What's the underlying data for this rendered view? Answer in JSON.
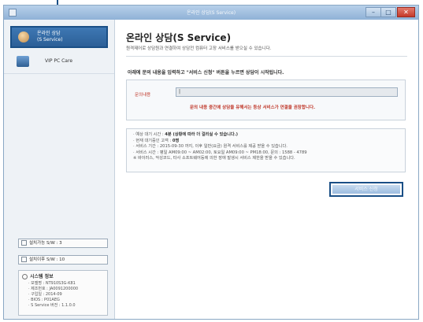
{
  "window": {
    "title": "온라인 상담(S Service)",
    "min_symbol": "–",
    "max_symbol": "□",
    "close_symbol": "✕"
  },
  "sidebar": {
    "active_item": {
      "line1": "온라인 상담",
      "line2": "(S Service)",
      "icon": "consultant-avatar-icon"
    },
    "vip_item": {
      "label": "VIP PC Care",
      "icon": "monitor-icon"
    },
    "buttons": [
      {
        "label": "설치가능 S/W : 3",
        "icon": "software-icon"
      },
      {
        "label": "설치이후 S/W : 10",
        "icon": "software-icon"
      }
    ],
    "system_info": {
      "title": "시스템 정보",
      "rows": [
        "· 모델명 : NT910S3G-K81",
        "· 제조번호 : JA0091200000",
        "· 구입일 : 2014-09",
        "· BIOS : P01AEG",
        "· S Service 버전 : 1.1.0.0"
      ]
    }
  },
  "main": {
    "title": "온라인 상담(S Service)",
    "description": "원격제어로 상담원과 연결하여 상담전 컴퓨터 고장 서비스를 받으실 수 있습니다.",
    "instruction": "아래에 문의 내용을 입력하고 \"서비스 신청\" 버튼을 누르면 상담이 시작됩니다.",
    "inquiry": {
      "label": "문의내용",
      "value": "|",
      "warning": "문의 내용 중간에 상담을 유해서는 등상 서비스가 연결을 권장합니다."
    },
    "info_rows": [
      {
        "label": "· 예상 대기 시간 : ",
        "value": "4분 (상황에 따라 더 걸리실 수 있습니다.)"
      },
      {
        "label": "· 현재 대기중인 고객 : ",
        "value": "0명"
      },
      {
        "label": "",
        "value": "· 서비스 기간 : 2015-09-30 까지, 이후 일반(요금) 원격 서비스를 제공 받을 수 있습니다."
      },
      {
        "label": "",
        "value": "· 서비스 시간 : 평일 AM09:00 ~ AM02:00, 토요일 AM09:00 ~ PM18:00, 문의 : 1588 - 4789"
      },
      {
        "label": "",
        "value": "※ 바이러스, 악성코드, 타사 소프트웨어등에 의한 장애 발생시 서비스 제한을 받을 수 있습니다."
      }
    ],
    "start_button": "서비스 신청"
  },
  "colors": {
    "accent": "#1a4f86",
    "titlebar": "#8fb1d6",
    "warning": "#c0392b"
  }
}
